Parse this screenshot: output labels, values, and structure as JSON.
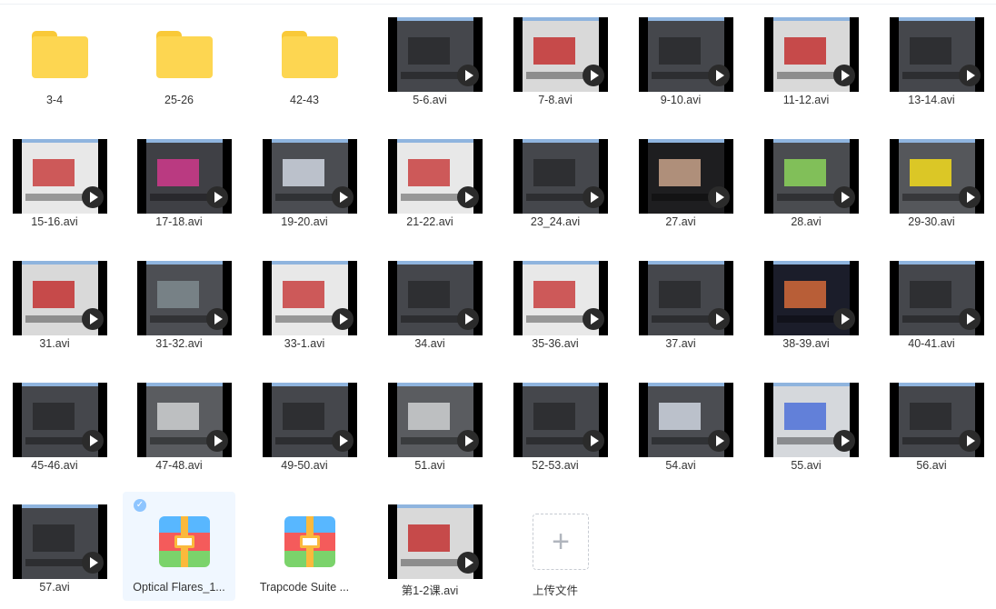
{
  "files": [
    {
      "name": "3-4",
      "type": "folder"
    },
    {
      "name": "25-26",
      "type": "folder"
    },
    {
      "name": "42-43",
      "type": "folder"
    },
    {
      "name": "5-6.avi",
      "type": "video",
      "preview": "dark"
    },
    {
      "name": "7-8.avi",
      "type": "video",
      "preview": "red"
    },
    {
      "name": "9-10.avi",
      "type": "video",
      "preview": "dark"
    },
    {
      "name": "11-12.avi",
      "type": "video",
      "preview": "red"
    },
    {
      "name": "13-14.avi",
      "type": "video",
      "preview": "dark"
    },
    {
      "name": "15-16.avi",
      "type": "video",
      "preview": "white"
    },
    {
      "name": "17-18.avi",
      "type": "video",
      "preview": "pink"
    },
    {
      "name": "19-20.avi",
      "type": "video",
      "preview": "dialog"
    },
    {
      "name": "21-22.avi",
      "type": "video",
      "preview": "white"
    },
    {
      "name": "23_24.avi",
      "type": "video",
      "preview": "dark"
    },
    {
      "name": "27.avi",
      "type": "video",
      "preview": "photo"
    },
    {
      "name": "28.avi",
      "type": "video",
      "preview": "green"
    },
    {
      "name": "29-30.avi",
      "type": "video",
      "preview": "yellow"
    },
    {
      "name": "31.avi",
      "type": "video",
      "preview": "red"
    },
    {
      "name": "31-32.avi",
      "type": "video",
      "preview": "sphere"
    },
    {
      "name": "33-1.avi",
      "type": "video",
      "preview": "white"
    },
    {
      "name": "34.avi",
      "type": "video",
      "preview": "dark"
    },
    {
      "name": "35-36.avi",
      "type": "video",
      "preview": "white"
    },
    {
      "name": "37.avi",
      "type": "video",
      "preview": "dark"
    },
    {
      "name": "38-39.avi",
      "type": "video",
      "preview": "city"
    },
    {
      "name": "40-41.avi",
      "type": "video",
      "preview": "dark"
    },
    {
      "name": "45-46.avi",
      "type": "video",
      "preview": "dark"
    },
    {
      "name": "47-48.avi",
      "type": "video",
      "preview": "grey"
    },
    {
      "name": "49-50.avi",
      "type": "video",
      "preview": "dark"
    },
    {
      "name": "51.avi",
      "type": "video",
      "preview": "grey"
    },
    {
      "name": "52-53.avi",
      "type": "video",
      "preview": "dark"
    },
    {
      "name": "54.avi",
      "type": "video",
      "preview": "dialog"
    },
    {
      "name": "55.avi",
      "type": "video",
      "preview": "balls"
    },
    {
      "name": "56.avi",
      "type": "video",
      "preview": "dark"
    },
    {
      "name": "57.avi",
      "type": "video",
      "preview": "dark"
    },
    {
      "name": "Optical Flares_1...",
      "type": "archive",
      "selected": true
    },
    {
      "name": "Trapcode Suite ...",
      "type": "archive"
    },
    {
      "name": "第1-2课.avi",
      "type": "video",
      "preview": "red"
    },
    {
      "name": "上传文件",
      "type": "upload"
    }
  ],
  "upload_plus": "+",
  "check_mark": "✓"
}
